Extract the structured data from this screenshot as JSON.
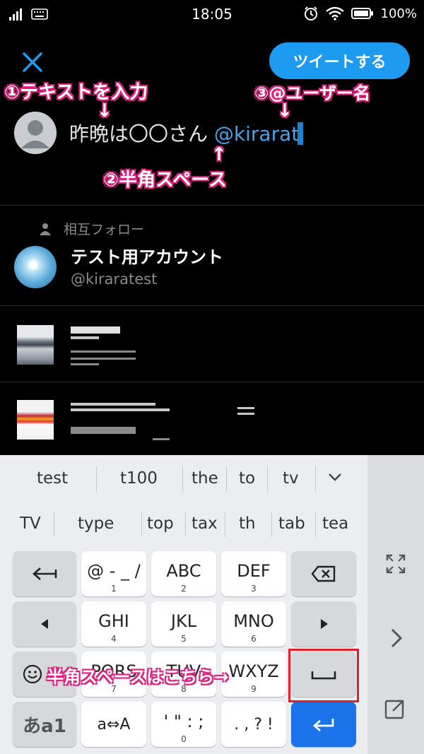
{
  "status_bar": {
    "time": "18:05",
    "battery": "100%",
    "icons": [
      "signal-icon",
      "keyboard-icon",
      "alarm-icon",
      "wifi-icon",
      "battery-icon"
    ]
  },
  "compose": {
    "tweet_button": "ツイートする",
    "text_plain": "昨晩は〇〇さん ",
    "mention": "@kirarat"
  },
  "annotations": {
    "step1": "①テキストを入力",
    "step2": "②半角スペース",
    "step3": "③@ユーザー名",
    "space_hint": "半角スペースはこちら→",
    "arrow_down": "↓",
    "arrow_up": "↑"
  },
  "suggestions": {
    "mutual_label": "相互フォロー",
    "account_name": "テスト用アカウント",
    "account_handle": "@kiraratest"
  },
  "keyboard": {
    "suggest_row1": [
      "test",
      "t100",
      "the",
      "to",
      "tv"
    ],
    "suggest_row2": [
      "TV",
      "type",
      "top",
      "tax",
      "th",
      "tab",
      "tea"
    ],
    "keys": {
      "k1": {
        "main": "@ - _ /",
        "sub": "1"
      },
      "k2": {
        "main": "ABC",
        "sub": "2"
      },
      "k3": {
        "main": "DEF",
        "sub": "3"
      },
      "k4": {
        "main": "GHI",
        "sub": "4"
      },
      "k5": {
        "main": "JKL",
        "sub": "5"
      },
      "k6": {
        "main": "MNO",
        "sub": "6"
      },
      "k7": {
        "main": "PQRS",
        "sub": "7"
      },
      "k8": {
        "main": "TUV",
        "sub": "8"
      },
      "k9": {
        "main": "WXYZ",
        "sub": "9"
      },
      "k0": {
        "main": "' \" : ;",
        "sub": "0"
      },
      "kcase": {
        "main": "a⇔A"
      },
      "kpunct": {
        "main": ". , ? !"
      },
      "kmode": {
        "main": "あa1"
      }
    }
  },
  "colors": {
    "accent": "#1d9bf0",
    "annotation": "#e0207f",
    "highlight": "#e0202a",
    "enter": "#1a73e8"
  }
}
